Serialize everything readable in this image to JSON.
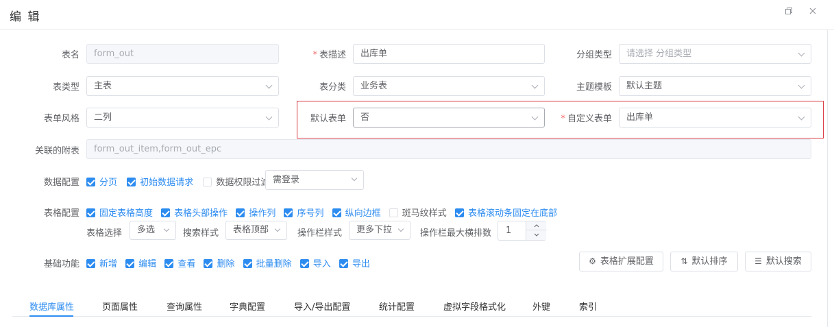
{
  "dialog": {
    "title": "编 辑"
  },
  "fields": {
    "table_name": {
      "label": "表名",
      "value": "form_out"
    },
    "table_desc": {
      "label": "表描述",
      "value": "出库单",
      "required": true
    },
    "group_type": {
      "label": "分组类型",
      "placeholder": "请选择 分组类型"
    },
    "table_type": {
      "label": "表类型",
      "value": "主表"
    },
    "table_category": {
      "label": "表分类",
      "value": "业务表"
    },
    "theme_template": {
      "label": "主题模板",
      "value": "默认主题"
    },
    "form_style": {
      "label": "表单风格",
      "value": "二列"
    },
    "default_form": {
      "label": "默认表单",
      "value": "否"
    },
    "custom_form": {
      "label": "自定义表单",
      "value": "出库单",
      "required": true
    },
    "linked_tables": {
      "label": "关联的附表",
      "value": "form_out_item,form_out_epc"
    }
  },
  "data_config": {
    "label": "数据配置",
    "checks": [
      {
        "label": "分页",
        "checked": true
      },
      {
        "label": "初始数据请求",
        "checked": true
      },
      {
        "label": "数据权限过滤",
        "checked": false
      }
    ],
    "login_select": "需登录"
  },
  "table_config": {
    "label": "表格配置",
    "checks": [
      {
        "label": "固定表格高度",
        "checked": true
      },
      {
        "label": "表格头部操作",
        "checked": true
      },
      {
        "label": "操作列",
        "checked": true
      },
      {
        "label": "序号列",
        "checked": true
      },
      {
        "label": "纵向边框",
        "checked": true
      },
      {
        "label": "斑马纹样式",
        "checked": false
      },
      {
        "label": "表格滚动条固定在底部",
        "checked": true
      }
    ],
    "selection_label": "表格选择",
    "selection_value": "多选",
    "search_style_label": "搜索样式",
    "search_style_value": "表格顶部",
    "op_style_label": "操作栏样式",
    "op_style_value": "更多下拉",
    "op_max_label": "操作栏最大横排数",
    "op_max_value": "1"
  },
  "basic": {
    "label": "基础功能",
    "checks": [
      {
        "label": "新增",
        "checked": true
      },
      {
        "label": "编辑",
        "checked": true
      },
      {
        "label": "查看",
        "checked": true
      },
      {
        "label": "删除",
        "checked": true
      },
      {
        "label": "批量删除",
        "checked": true
      },
      {
        "label": "导入",
        "checked": true
      },
      {
        "label": "导出",
        "checked": true
      }
    ],
    "buttons": {
      "ext_config": "表格扩展配置",
      "default_sort": "默认排序",
      "default_search": "默认搜索"
    }
  },
  "tabs": [
    "数据库属性",
    "页面属性",
    "查询属性",
    "字典配置",
    "导入/导出配置",
    "统计配置",
    "虚拟字段格式化",
    "外键",
    "索引"
  ],
  "colors": {
    "accent": "#2d8cf0",
    "highlight_border": "#d9363e",
    "required": "#f56c6c"
  }
}
